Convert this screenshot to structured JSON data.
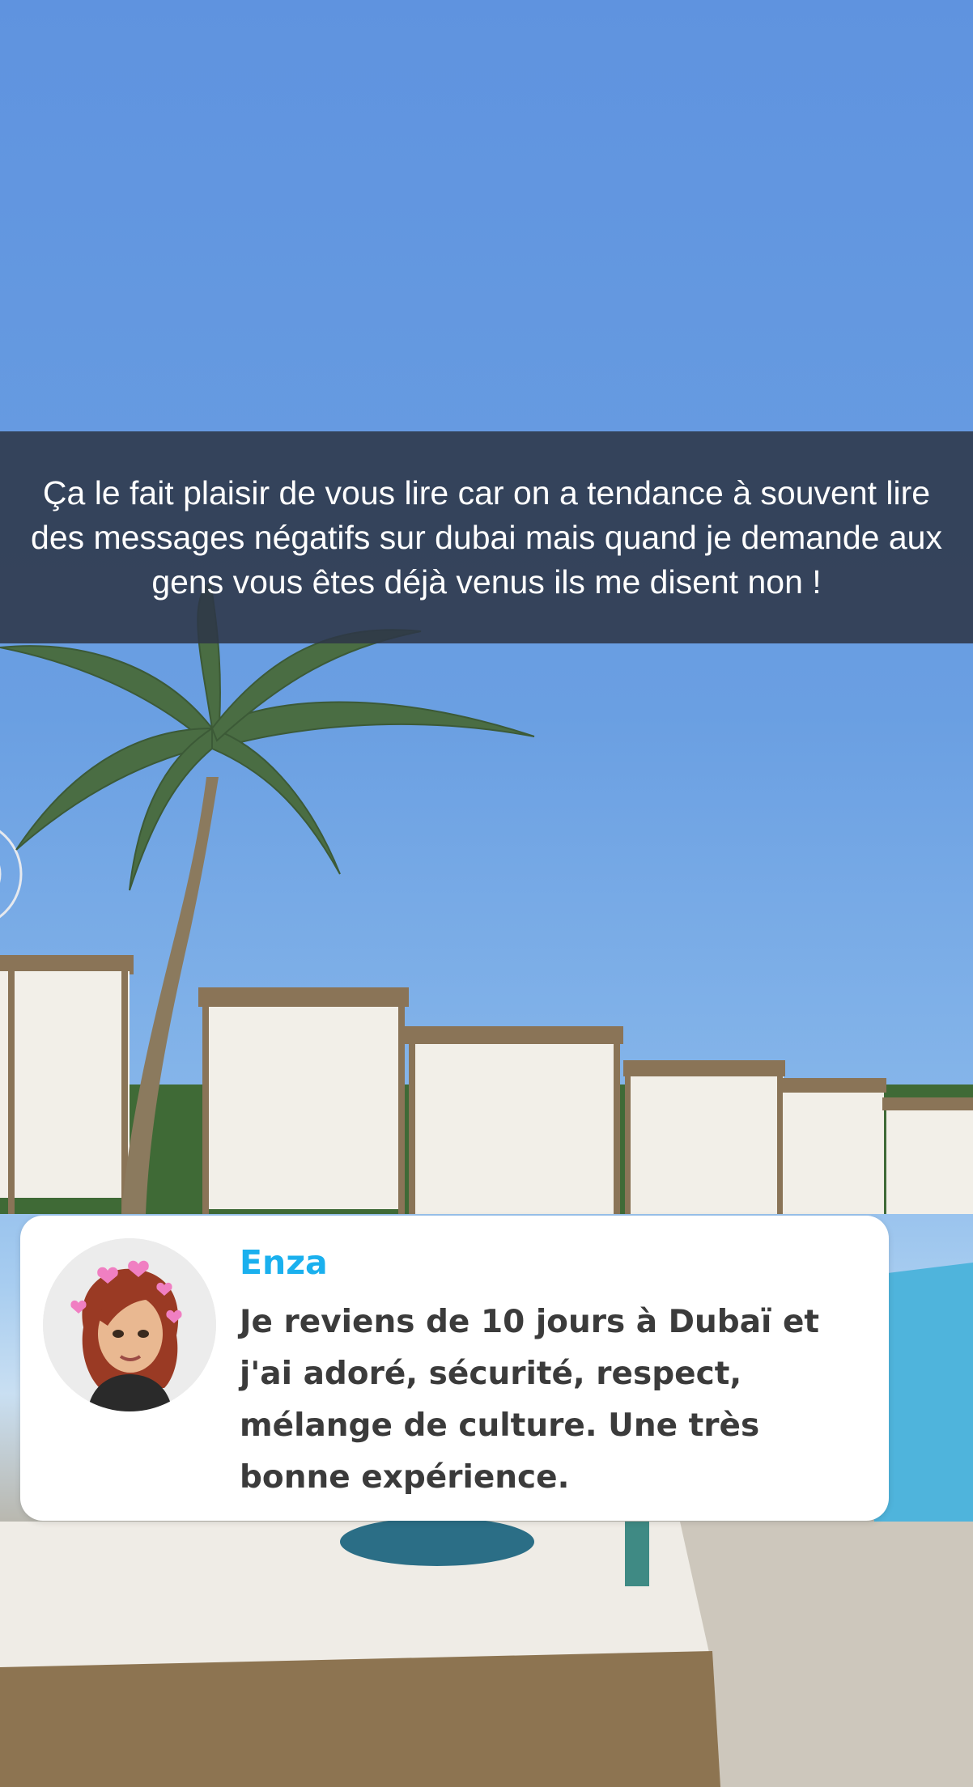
{
  "story": {
    "caption": "Ça le fait plaisir de vous lire car on a tendance à souvent lire des messages négatifs sur dubai mais quand je demande aux gens vous êtes déjà venus ils me disent non !"
  },
  "reply": {
    "name": "Enza",
    "message": "Je reviens de 10 jours à Dubaï et j'ai adoré, sécurité, respect, mélange de culture. Une très bonne expérience.",
    "avatar_icon": "bitmoji-avatar-icon",
    "name_color": "#1ab0ee"
  },
  "colors": {
    "sky": "#5f93df",
    "caption_bg": "#2d3748",
    "card_bg": "#ffffff"
  }
}
